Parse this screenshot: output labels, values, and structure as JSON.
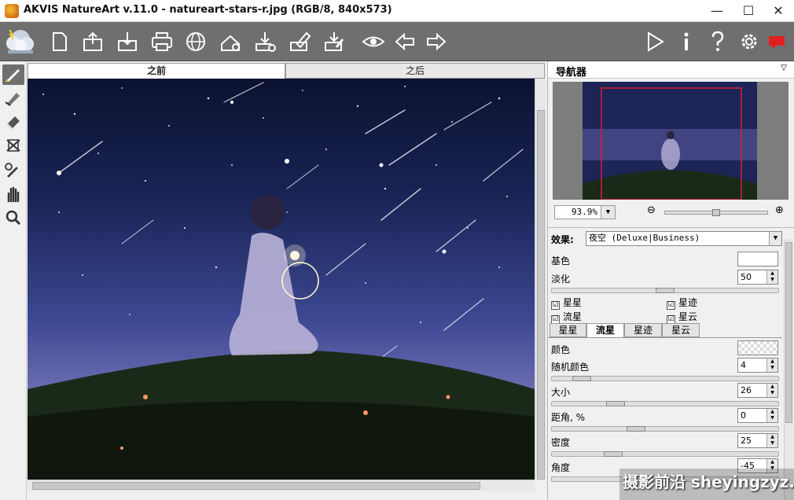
{
  "window": {
    "title": "AKVIS NatureArt v.11.0 - natureart-stars-r.jpg (RGB/8, 840x573)",
    "controls": [
      "—",
      "☐",
      "✕"
    ]
  },
  "toolbar": {
    "left_icons": [
      "cloud-logo-icon",
      "new-file-icon",
      "open-file-icon",
      "save-file-icon",
      "print-icon",
      "share-globe-icon",
      "import-preset-icon",
      "export-preset-icon",
      "edit-preset-icon",
      "edit-preset-2-icon",
      "show-hide-icon",
      "undo-icon",
      "redo-icon"
    ],
    "right_icons": [
      "run-icon",
      "info-icon",
      "help-icon",
      "settings-icon",
      "news-icon"
    ]
  },
  "left_tools": [
    "brush-tool-icon",
    "eraser-brush-tool-icon",
    "eraser-tool-icon",
    "crop-tool-icon",
    "eyedropper-tool-icon",
    "hand-tool-icon",
    "zoom-tool-icon"
  ],
  "view_tabs": {
    "before": "之前",
    "after": "之后"
  },
  "navigator": {
    "title": "导航器",
    "zoom_value": "93.9%",
    "zoom_out": "⊖",
    "zoom_in": "⊕"
  },
  "effect": {
    "label": "效果:",
    "value": "夜空 (Deluxe|Business)"
  },
  "params_top": {
    "base_color_label": "基色",
    "fade_label": "淡化",
    "fade_value": "50",
    "fade_level": 0.5,
    "checks": [
      {
        "label": "星星",
        "checked": "☑"
      },
      {
        "label": "星迹",
        "checked": "☑"
      },
      {
        "label": "流星",
        "checked": "☑"
      },
      {
        "label": "星云",
        "checked": "☑"
      }
    ]
  },
  "sub_tabs": [
    "星星",
    "流星",
    "星迹",
    "星云"
  ],
  "meteor_params": [
    {
      "label": "颜色",
      "type": "swatch"
    },
    {
      "label": "随机颜色",
      "value": "4",
      "level": 0.1
    },
    {
      "label": "大小",
      "value": "26",
      "level": 0.26
    },
    {
      "label": "距角, %",
      "value": "0",
      "level": 0.36
    },
    {
      "label": "密度",
      "value": "25",
      "level": 0.25
    },
    {
      "label": "角度",
      "value": "-45",
      "level": 0.35
    }
  ],
  "watermark": "摄影前沿 sheyingzyz.com",
  "colors": {
    "toolbar_bg": "#6f6f6f",
    "selection_frame": "#d81c3c",
    "news_icon": "#e02020"
  }
}
